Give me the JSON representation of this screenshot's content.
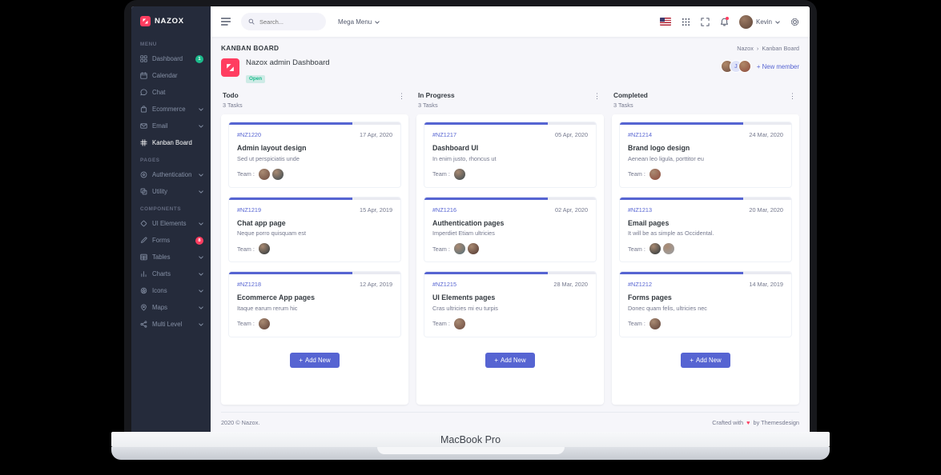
{
  "device": {
    "label": "MacBook Pro"
  },
  "icons": {
    "dots_vertical": "⋮",
    "heart": "♥",
    "plus": "+",
    "breadcrumb_sep": "›"
  },
  "sidebar": {
    "logo_text": "NAZOX",
    "sections": [
      {
        "label": "MENU",
        "items": [
          {
            "label": "Dashboard",
            "icon": "dashboard-icon",
            "badge": "1",
            "badge_color": "#1cbb8c"
          },
          {
            "label": "Calendar",
            "icon": "calendar-icon"
          },
          {
            "label": "Chat",
            "icon": "chat-icon"
          },
          {
            "label": "Ecommerce",
            "icon": "ecommerce-icon",
            "chevron": true
          },
          {
            "label": "Email",
            "icon": "email-icon",
            "chevron": true
          },
          {
            "label": "Kanban Board",
            "icon": "kanban-icon",
            "active": true
          }
        ]
      },
      {
        "label": "PAGES",
        "items": [
          {
            "label": "Authentication",
            "icon": "authentication-icon",
            "chevron": true
          },
          {
            "label": "Utility",
            "icon": "utility-icon",
            "chevron": true
          }
        ]
      },
      {
        "label": "COMPONENTS",
        "items": [
          {
            "label": "UI Elements",
            "icon": "ui-elements-icon",
            "chevron": true
          },
          {
            "label": "Forms",
            "icon": "forms-icon",
            "badge": "8",
            "badge_color": "#ff3d60"
          },
          {
            "label": "Tables",
            "icon": "tables-icon",
            "chevron": true
          },
          {
            "label": "Charts",
            "icon": "charts-icon",
            "chevron": true
          },
          {
            "label": "Icons",
            "icon": "icons-icon",
            "chevron": true
          },
          {
            "label": "Maps",
            "icon": "maps-icon",
            "chevron": true
          },
          {
            "label": "Multi Level",
            "icon": "multi-level-icon",
            "chevron": true
          }
        ]
      }
    ]
  },
  "topbar": {
    "search_placeholder": "Search...",
    "mega_menu_label": "Mega Menu",
    "user_name": "Kevin"
  },
  "page": {
    "title": "KANBAN BOARD",
    "breadcrumb": [
      "Nazox",
      "Kanban Board"
    ],
    "project": {
      "name": "Nazox admin Dashboard",
      "status": "Open"
    },
    "members": [
      {
        "color": "#6d4c41"
      },
      {
        "initial": "J"
      },
      {
        "color": "#8d4a3c"
      }
    ],
    "new_member_label": "+ New member"
  },
  "board": {
    "team_label": "Team :",
    "add_new_label": "Add New",
    "columns": [
      {
        "name": "Todo",
        "tasks_label": "3 Tasks",
        "cards": [
          {
            "id": "#NZ1220",
            "date": "17 Apr, 2020",
            "title": "Admin layout design",
            "desc": "Sed ut perspiciatis unde",
            "progress": 72,
            "team": [
              "#6d4c41",
              "#37474f"
            ]
          },
          {
            "id": "#NZ1219",
            "date": "15 Apr, 2019",
            "title": "Chat app page",
            "desc": "Neque porro quisquam est",
            "progress": 72,
            "team": [
              "#263238"
            ]
          },
          {
            "id": "#NZ1218",
            "date": "12 Apr, 2019",
            "title": "Ecommerce App pages",
            "desc": "Itaque earum rerum hic",
            "progress": 72,
            "team": [
              "#5d4037"
            ]
          }
        ]
      },
      {
        "name": "In Progress",
        "tasks_label": "3 Tasks",
        "cards": [
          {
            "id": "#NZ1217",
            "date": "05 Apr, 2020",
            "title": "Dashboard UI",
            "desc": "In enim justo, rhoncus ut",
            "progress": 72,
            "team": [
              "#37474f"
            ]
          },
          {
            "id": "#NZ1216",
            "date": "02 Apr, 2020",
            "title": "Authentication pages",
            "desc": "Imperdiet Etiam ultricies",
            "progress": 72,
            "team": [
              "#546e7a",
              "#4e342e"
            ]
          },
          {
            "id": "#NZ1215",
            "date": "28 Mar, 2020",
            "title": "UI Elements pages",
            "desc": "Cras ultricies mi eu turpis",
            "progress": 72,
            "team": [
              "#6d4c41"
            ]
          }
        ]
      },
      {
        "name": "Completed",
        "tasks_label": "3 Tasks",
        "cards": [
          {
            "id": "#NZ1214",
            "date": "24 Mar, 2020",
            "title": "Brand logo design",
            "desc": "Aenean leo ligula, porttitor eu",
            "progress": 72,
            "team": [
              "#8d4a3c"
            ]
          },
          {
            "id": "#NZ1213",
            "date": "20 Mar, 2020",
            "title": "Email pages",
            "desc": "It will be as simple as Occidental.",
            "progress": 72,
            "team": [
              "#263238",
              "#9aa0a6"
            ]
          },
          {
            "id": "#NZ1212",
            "date": "14 Mar, 2019",
            "title": "Forms pages",
            "desc": "Donec quam felis, ultricies nec",
            "progress": 72,
            "team": [
              "#5d4037"
            ]
          }
        ]
      }
    ]
  },
  "footer": {
    "left": "2020 © Nazox.",
    "right_prefix": "Crafted with",
    "right_suffix": "by Themesdesign"
  },
  "colors": {
    "primary": "#5664d2",
    "success": "#1cbb8c",
    "danger": "#ff3d60",
    "sidebar_bg": "#252b3b"
  }
}
